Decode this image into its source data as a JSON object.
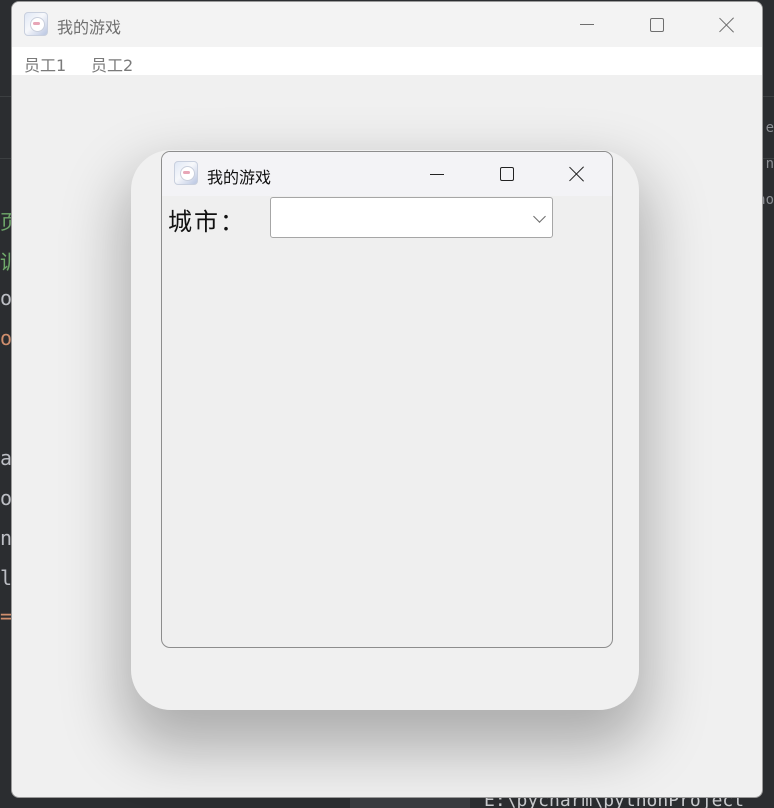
{
  "main_window": {
    "title": "我的游戏",
    "menu": [
      "员工1",
      "员工2"
    ]
  },
  "dialog": {
    "title": "我的游戏",
    "city_label": "城市：",
    "city_select": {
      "value": "",
      "options": []
    }
  },
  "background_ide": {
    "left_fragments": [
      "页",
      "训",
      "ob",
      "ow",
      "a",
      "o",
      "no",
      "le",
      "="
    ],
    "right_fragments": [
      "je",
      "n",
      "no"
    ],
    "bottom_text": "E:\\pycharm\\pythonProject"
  },
  "icons": {
    "app": "app-icon",
    "minimize": "minimize-icon",
    "maximize": "maximize-icon",
    "close": "close-icon",
    "dropdown": "chevron-down-icon"
  }
}
